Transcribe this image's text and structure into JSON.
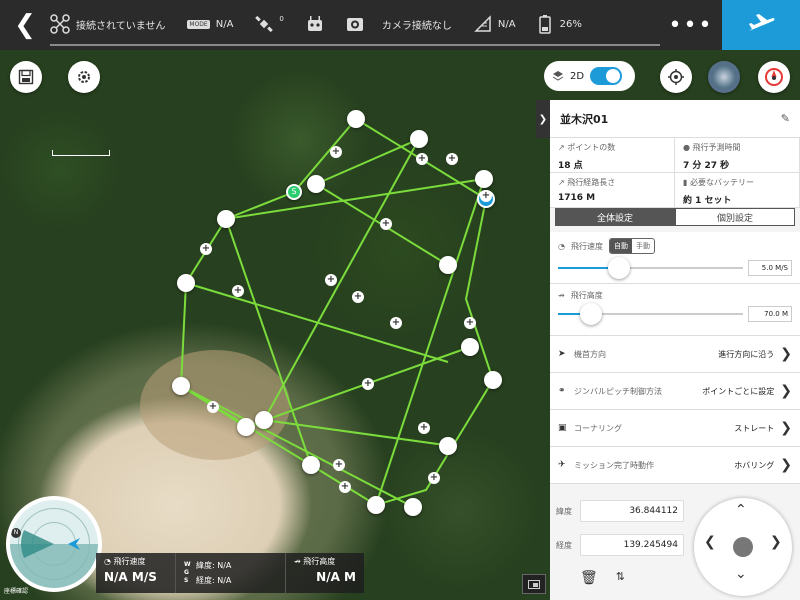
{
  "topbar": {
    "connection": "接続されていません",
    "mode_badge": "MODE",
    "mode_value": "N/A",
    "gps_count": "0",
    "camera": "カメラ接続なし",
    "flight_mode_value": "N/A",
    "battery": "26%"
  },
  "map": {
    "view_label": "2D",
    "start_marker": "S"
  },
  "mission": {
    "name": "並木沢01",
    "stats": [
      {
        "label": "ポイントの数",
        "value": "18 点"
      },
      {
        "label": "飛行予測時間",
        "value": "7 分 27 秒"
      },
      {
        "label": "飛行経路長さ",
        "value": "1716 M"
      },
      {
        "label": "必要なバッテリー",
        "value": "約 1 セット"
      }
    ],
    "tabs": [
      "全体設定",
      "個別設定"
    ],
    "speed": {
      "label": "飛行速度",
      "auto": "自動",
      "manual": "手動",
      "value": "5.0 M/S",
      "fraction": 0.33
    },
    "altitude": {
      "label": "飛行高度",
      "value": "70.0 M",
      "fraction": 0.18
    },
    "rows": [
      {
        "label": "機首方向",
        "value": "進行方向に沿う"
      },
      {
        "label": "ジンバルピッチ制御方法",
        "value": "ポイントごとに設定"
      },
      {
        "label": "コーナリング",
        "value": "ストレート"
      },
      {
        "label": "ミッション完了時動作",
        "value": "ホバリング"
      }
    ]
  },
  "coords": {
    "lat_label": "緯度",
    "lat": "36.844112",
    "lon_label": "経度",
    "lon": "139.245494"
  },
  "telemetry": {
    "speed_label": "飛行速度",
    "speed": "N/A M/S",
    "wgs": "W G S",
    "lat_label": "緯度: N/A",
    "lon_label": "経度: N/A",
    "alt_label": "飛行高度",
    "alt": "N/A M"
  },
  "radar": {
    "north": "N",
    "coord_label": "座標確認"
  },
  "colors": {
    "accent": "#1d9bd9",
    "path": "#7bdc3c",
    "start": "#2ecc71"
  }
}
